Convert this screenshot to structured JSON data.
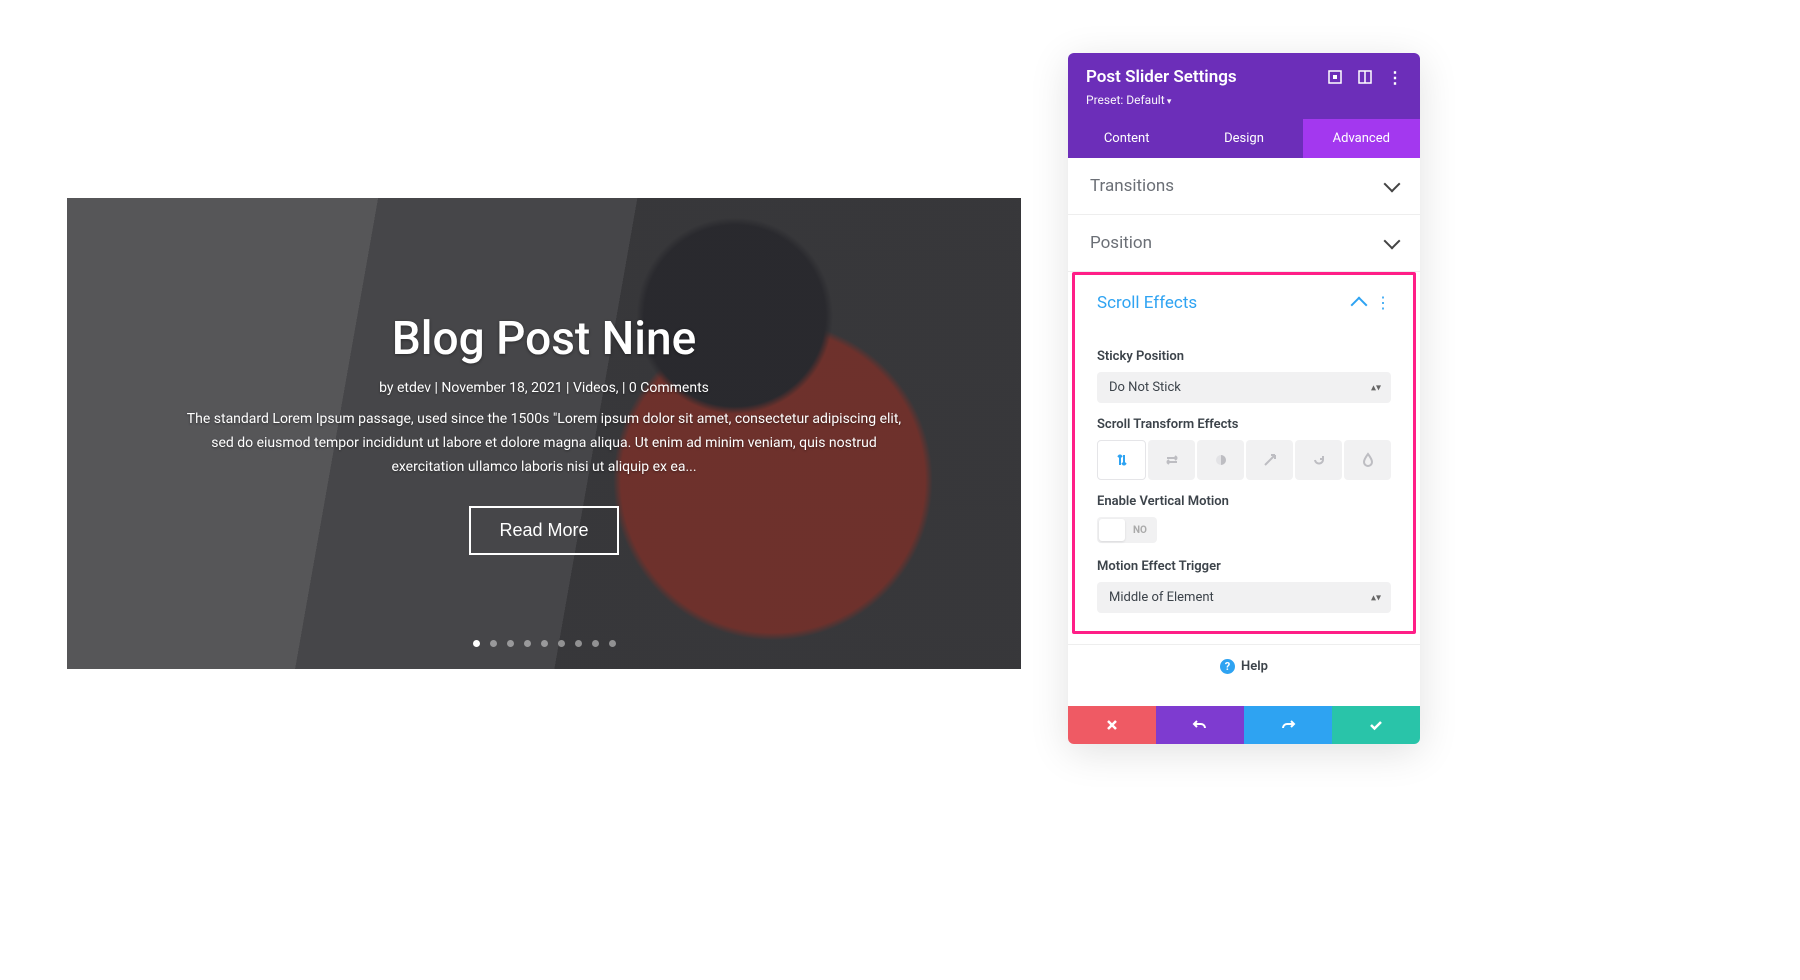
{
  "slider": {
    "title": "Blog Post Nine",
    "meta": "by etdev | November 18, 2021 | Videos, | 0 Comments",
    "description": "The standard Lorem Ipsum passage, used since the 1500s \"Lorem ipsum dolor sit amet, consectetur adipiscing elit, sed do eiusmod tempor incididunt ut labore et dolore magna aliqua. Ut enim ad minim veniam, quis nostrud exercitation ullamco laboris nisi ut aliquip ex ea...",
    "button": "Read More",
    "dot_count": 9,
    "active_dot": 0
  },
  "panel": {
    "title": "Post Slider Settings",
    "preset": "Preset: Default",
    "tabs": [
      "Content",
      "Design",
      "Advanced"
    ],
    "active_tab": 2,
    "sections": {
      "transitions": "Transitions",
      "position": "Position",
      "scroll_effects": "Scroll Effects"
    },
    "fields": {
      "sticky_label": "Sticky Position",
      "sticky_value": "Do Not Stick",
      "transform_label": "Scroll Transform Effects",
      "vertical_label": "Enable Vertical Motion",
      "vertical_value": "NO",
      "trigger_label": "Motion Effect Trigger",
      "trigger_value": "Middle of Element"
    },
    "help": "Help"
  }
}
